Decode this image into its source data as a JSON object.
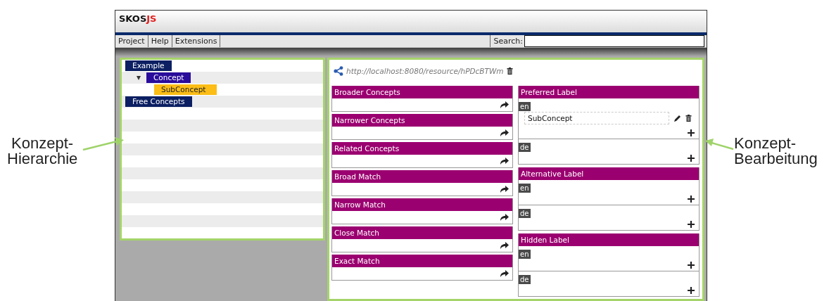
{
  "app": {
    "logo": {
      "main": "SKOS",
      "accent": "JS"
    },
    "menu": [
      {
        "label": "Project"
      },
      {
        "label": "Help"
      },
      {
        "label": "Extensions"
      }
    ],
    "search": {
      "label": "Search:"
    }
  },
  "tree": [
    {
      "label": "Example",
      "kind": "scheme",
      "selected": false,
      "children": [
        {
          "label": "Concept",
          "kind": "concept",
          "selected": false,
          "expanded": true,
          "children": [
            {
              "label": "SubConcept",
              "selected": true
            }
          ]
        }
      ]
    },
    {
      "label": "Free Concepts",
      "kind": "scheme",
      "selected": false
    }
  ],
  "editor": {
    "uri": "http://localhost:8080/resource/hPDcBTWm",
    "relations": [
      {
        "title": "Broader Concepts"
      },
      {
        "title": "Narrower Concepts"
      },
      {
        "title": "Related Concepts"
      },
      {
        "title": "Broad Match"
      },
      {
        "title": "Narrow Match"
      },
      {
        "title": "Close Match"
      },
      {
        "title": "Exact Match"
      }
    ],
    "labels": [
      {
        "title": "Preferred Label",
        "languages": [
          {
            "lang": "en",
            "values": [
              "SubConcept"
            ]
          },
          {
            "lang": "de"
          }
        ]
      },
      {
        "title": "Alternative Label",
        "languages": [
          {
            "lang": "en"
          },
          {
            "lang": "de"
          }
        ]
      },
      {
        "title": "Hidden Label",
        "languages": [
          {
            "lang": "en"
          },
          {
            "lang": "de"
          }
        ]
      }
    ]
  },
  "annotations": {
    "left": {
      "text": "Konzept-\nHierarchie"
    },
    "right": {
      "text": "Konzept-\nBearbeitung"
    }
  }
}
